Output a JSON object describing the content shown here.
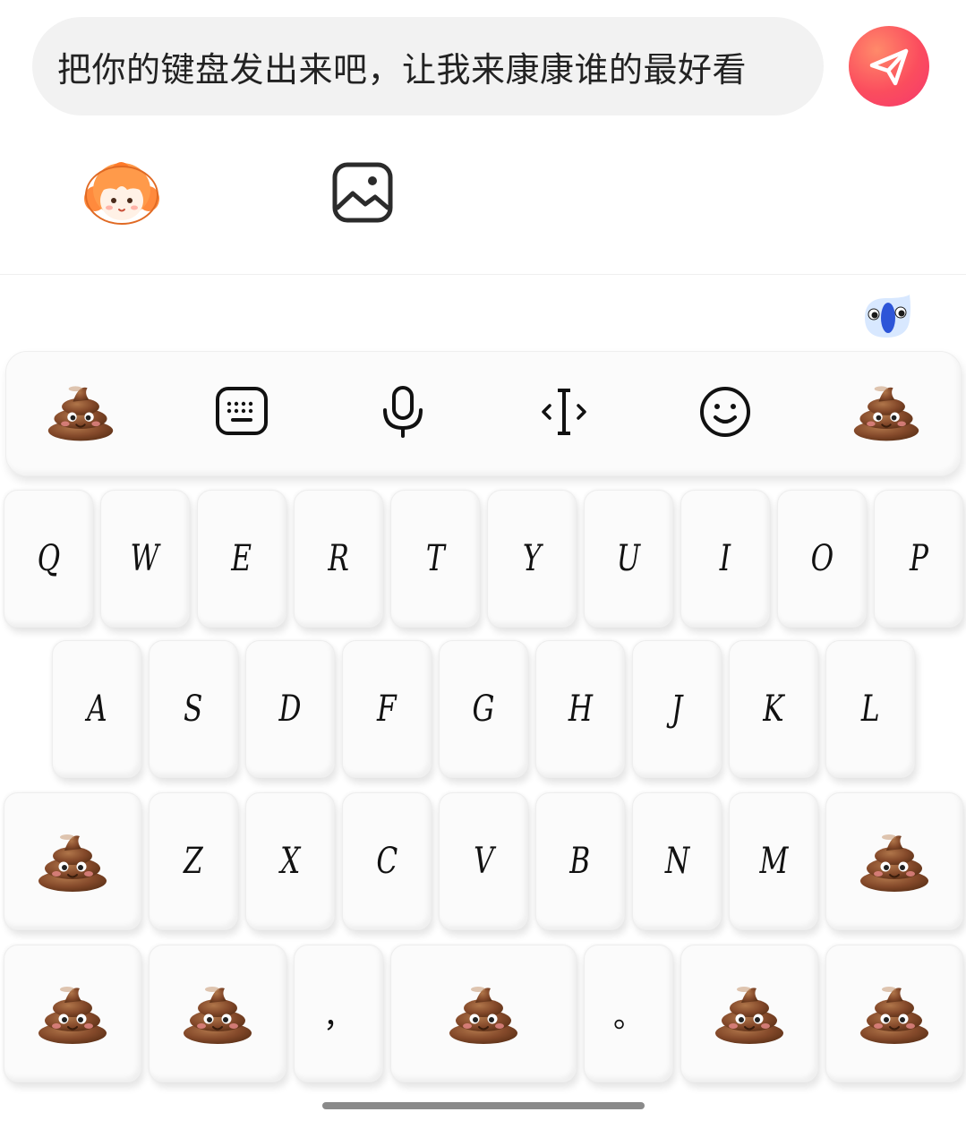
{
  "composer": {
    "input_text": "把你的键盘发出来吧，让我来康康谁的最好看"
  },
  "keyboard": {
    "toolbar": [
      "poo-emoji",
      "keyboard-icon",
      "microphone-icon",
      "cursor-move-icon",
      "smiley-icon",
      "poo-emoji"
    ],
    "row1": [
      "Q",
      "W",
      "E",
      "R",
      "T",
      "Y",
      "U",
      "I",
      "O",
      "P"
    ],
    "row2": [
      "A",
      "S",
      "D",
      "F",
      "G",
      "H",
      "J",
      "K",
      "L"
    ],
    "row3": [
      "Z",
      "X",
      "C",
      "V",
      "B",
      "N",
      "M"
    ],
    "row4": {
      "comma": "，",
      "period": "。"
    }
  },
  "colors": {
    "send_gradient_start": "#ff8a6a",
    "send_gradient_end": "#f5376d",
    "poo_brown": "#8a4f2a"
  }
}
